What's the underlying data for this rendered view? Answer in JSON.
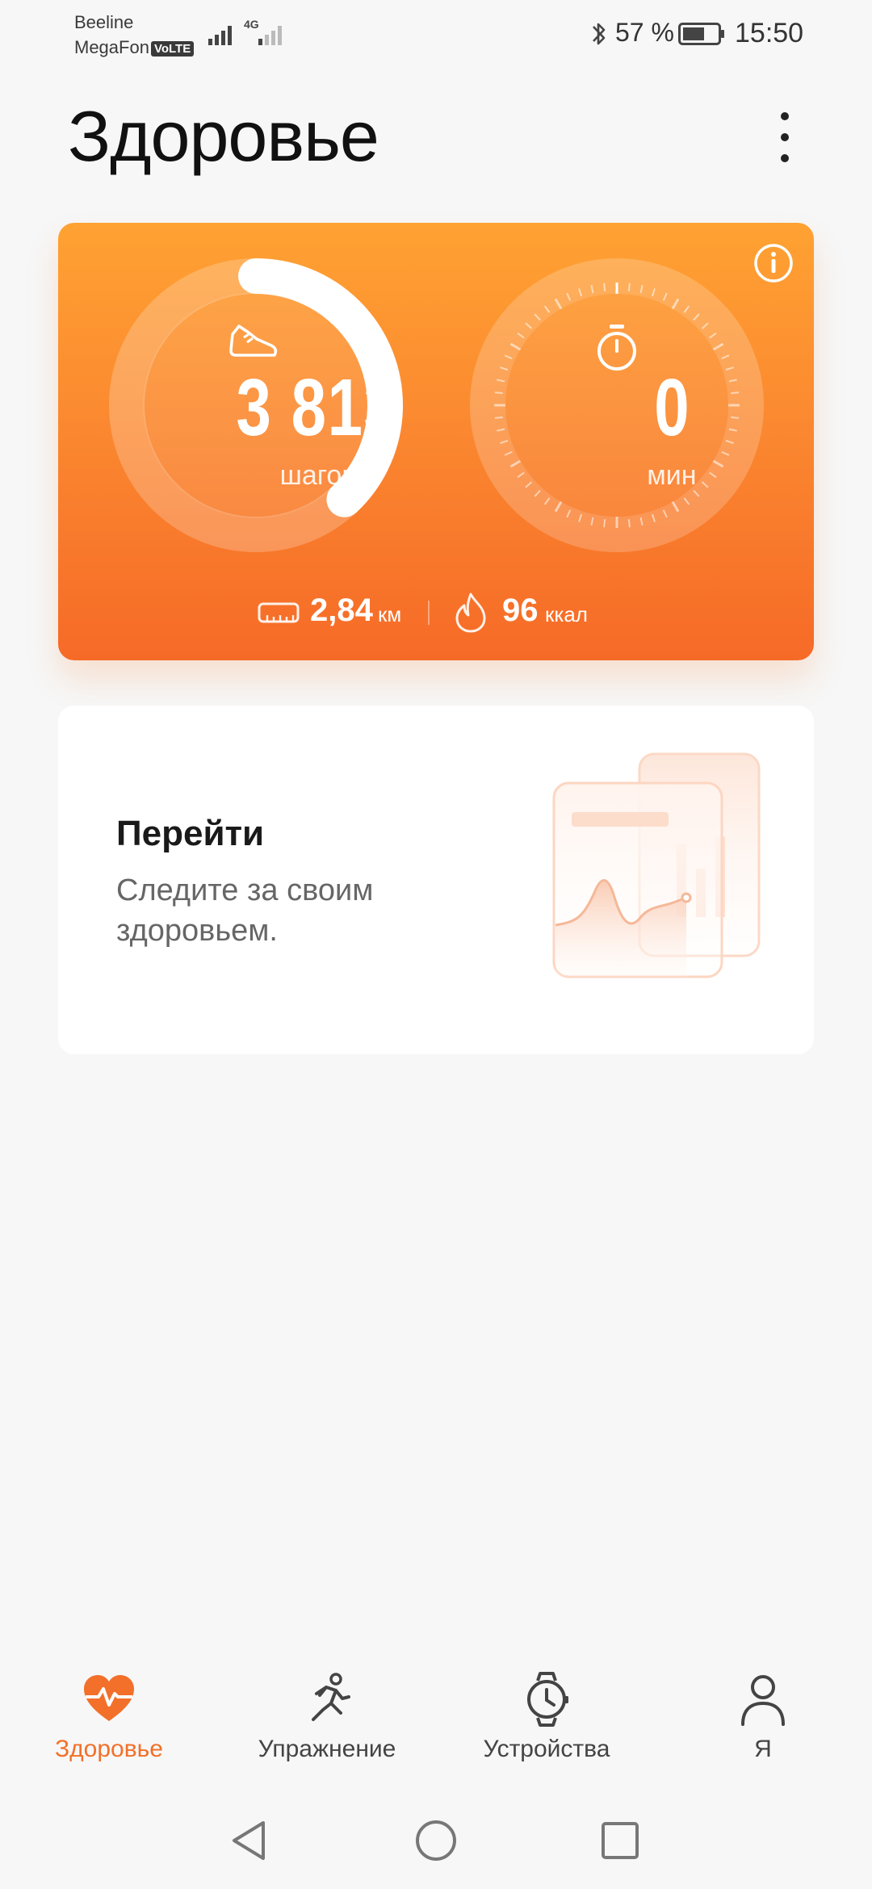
{
  "status_bar": {
    "carrier_1": "Beeline",
    "carrier_2": "MegaFon",
    "volte": "VoLTE",
    "network": "4G",
    "battery": "57 %",
    "time": "15:50"
  },
  "header": {
    "title": "Здоровье",
    "menu_icon": "more-vertical-icon"
  },
  "activity": {
    "steps_value": "3 813",
    "steps_label": "шагов",
    "steps_progress": 0.38,
    "minutes_value": "0",
    "minutes_label": "мин",
    "distance_value": "2,84",
    "distance_unit": "км",
    "calories_value": "96",
    "calories_unit": "ккал",
    "colors": {
      "card_top": "#ffa232",
      "card_bottom": "#f66a27"
    }
  },
  "promo": {
    "title": "Перейти",
    "subtitle": "Следите за своим здоровьем."
  },
  "bottom_nav": {
    "items": [
      {
        "label": "Здоровье",
        "icon": "heart-pulse-icon",
        "active": true
      },
      {
        "label": "Упражнение",
        "icon": "running-icon",
        "active": false
      },
      {
        "label": "Устройства",
        "icon": "watch-icon",
        "active": false
      },
      {
        "label": "Я",
        "icon": "person-icon",
        "active": false
      }
    ],
    "active_color": "#f2702a"
  },
  "system_nav": {
    "back_icon": "back-triangle-icon",
    "home_icon": "home-circle-icon",
    "recents_icon": "recents-square-icon"
  }
}
